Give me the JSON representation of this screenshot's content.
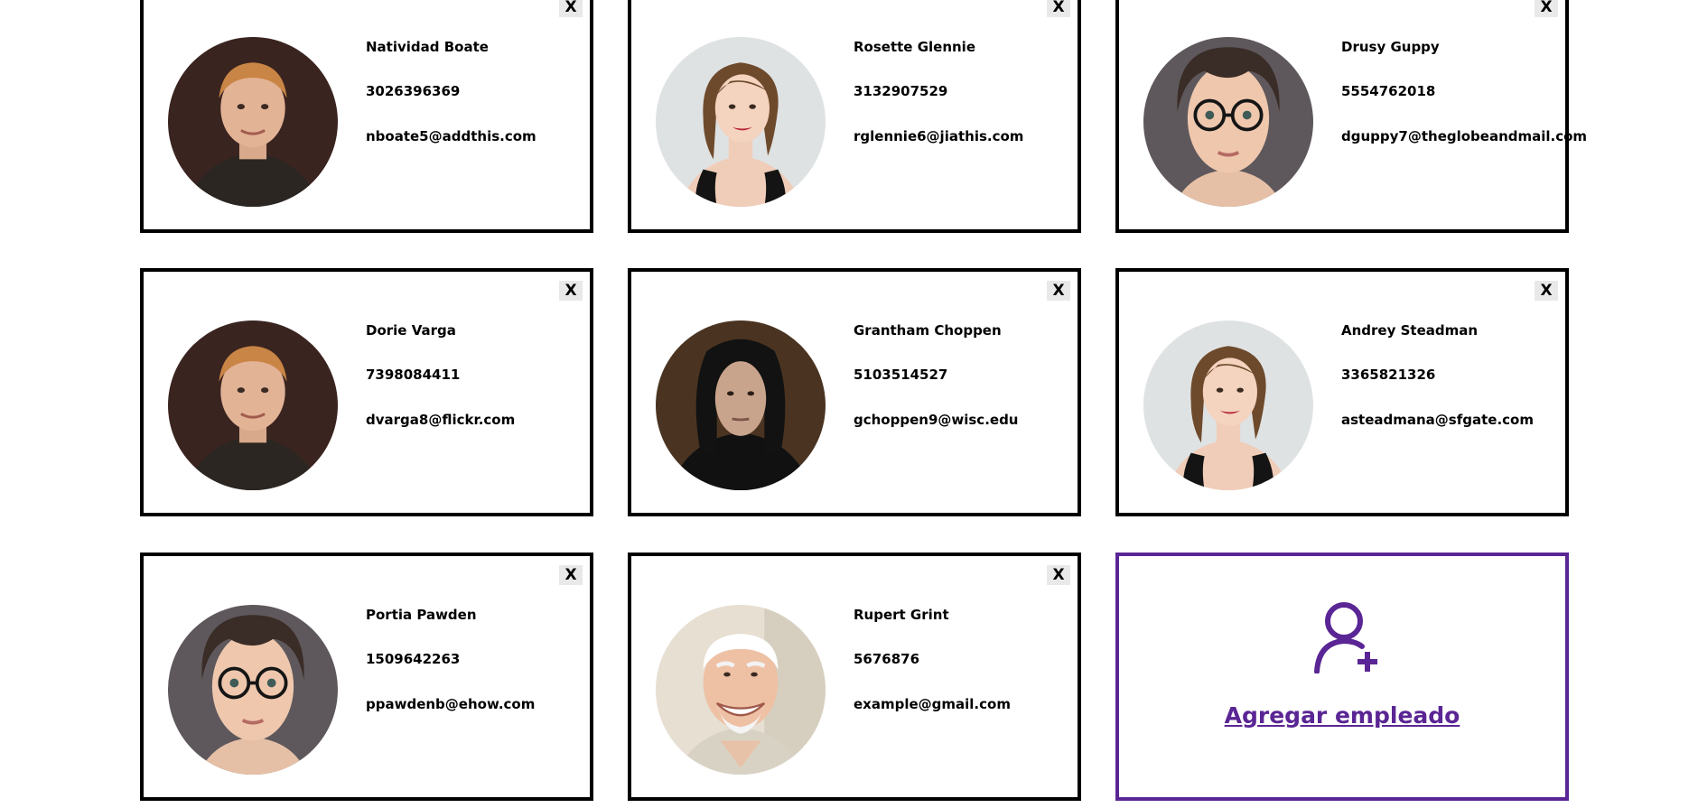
{
  "close_label": "X",
  "employees": [
    {
      "name": "Natividad Boate",
      "phone": "3026396369",
      "email": "nboate5@addthis.com",
      "avatar": "red-hair-man"
    },
    {
      "name": "Rosette Glennie",
      "phone": "3132907529",
      "email": "rglennie6@jiathis.com",
      "avatar": "brown-hair-woman"
    },
    {
      "name": "Drusy Guppy",
      "phone": "5554762018",
      "email": "dguppy7@theglobeandmail.com",
      "avatar": "boy-with-glasses"
    },
    {
      "name": "Dorie Varga",
      "phone": "7398084411",
      "email": "dvarga8@flickr.com",
      "avatar": "red-hair-man"
    },
    {
      "name": "Grantham Choppen",
      "phone": "5103514527",
      "email": "gchoppen9@wisc.edu",
      "avatar": "long-black-hair-man"
    },
    {
      "name": "Andrey Steadman",
      "phone": "3365821326",
      "email": "asteadmana@sfgate.com",
      "avatar": "brown-hair-woman"
    },
    {
      "name": "Portia Pawden",
      "phone": "1509642263",
      "email": "ppawdenb@ehow.com",
      "avatar": "boy-with-glasses"
    },
    {
      "name": "Rupert Grint",
      "phone": "5676876",
      "email": "example@gmail.com",
      "avatar": "smiling-old-man"
    }
  ],
  "add_employee": {
    "label": "Agregar empleado",
    "icon": "add-user-icon"
  },
  "colors": {
    "accent": "#5a2594",
    "border": "#000000",
    "close_bg": "#e9e9e9"
  }
}
